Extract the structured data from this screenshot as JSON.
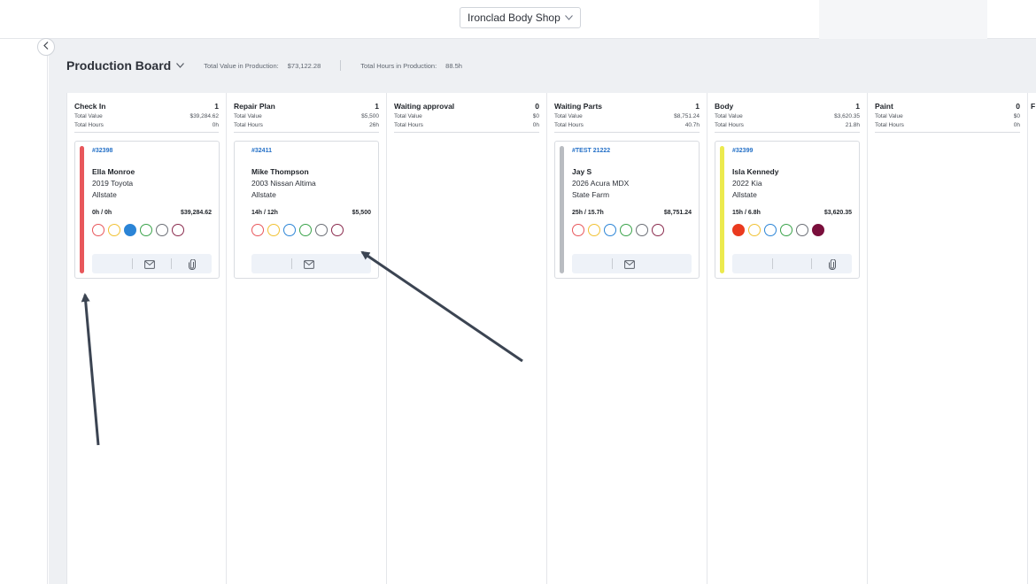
{
  "topbar": {
    "shop_name": "Ironclad Body Shop",
    "shop_chevron_icon": "chevron-down-icon"
  },
  "rail": {
    "collapse_icon": "chevron-left-icon"
  },
  "board": {
    "title": "Production Board",
    "total_value_label": "Total Value in Production:",
    "total_value": "$73,122.28",
    "total_hours_label": "Total Hours in Production:",
    "total_hours": "88.5h"
  },
  "columns": [
    {
      "name": "Check In",
      "count": "1",
      "value_label": "Total Value",
      "value": "$39,284.62",
      "hours_label": "Total Hours",
      "hours": "0h",
      "cards": [
        {
          "ro": "#32398",
          "customer": "Ella Monroe",
          "vehicle": "2019 Toyota",
          "insurer": "Allstate",
          "hours": "0h / 0h",
          "amount": "$39,284.62",
          "stripe_color": "#e8575b",
          "icons": [
            "mail-icon",
            "paperclip-icon"
          ],
          "dots": [
            {
              "stroke": "#e8575b",
              "fill": "none"
            },
            {
              "stroke": "#f1c233",
              "fill": "none"
            },
            {
              "stroke": "#2b84d6",
              "fill": "#2b84d6"
            },
            {
              "stroke": "#3aa34a",
              "fill": "none"
            },
            {
              "stroke": "#6b6f76",
              "fill": "none"
            },
            {
              "stroke": "#8a2a4d",
              "fill": "none"
            }
          ]
        }
      ]
    },
    {
      "name": "Repair Plan",
      "count": "1",
      "value_label": "Total Value",
      "value": "$5,500",
      "hours_label": "Total Hours",
      "hours": "26h",
      "cards": [
        {
          "ro": "#32411",
          "customer": "Mike Thompson",
          "vehicle": "2003 Nissan Altima",
          "insurer": "Allstate",
          "hours": "14h / 12h",
          "amount": "$5,500",
          "stripe_color": "",
          "icons": [
            "mail-icon"
          ],
          "dots": [
            {
              "stroke": "#e8575b",
              "fill": "none"
            },
            {
              "stroke": "#f1c233",
              "fill": "none"
            },
            {
              "stroke": "#2b84d6",
              "fill": "none"
            },
            {
              "stroke": "#3aa34a",
              "fill": "none"
            },
            {
              "stroke": "#6b6f76",
              "fill": "none"
            },
            {
              "stroke": "#8a2a4d",
              "fill": "none"
            }
          ]
        }
      ]
    },
    {
      "name": "Waiting approval",
      "count": "0",
      "value_label": "Total Value",
      "value": "$0",
      "hours_label": "Total Hours",
      "hours": "0h",
      "cards": []
    },
    {
      "name": "Waiting Parts",
      "count": "1",
      "value_label": "Total Value",
      "value": "$8,751.24",
      "hours_label": "Total Hours",
      "hours": "40.7h",
      "cards": [
        {
          "ro": "#TEST 21222",
          "customer": "Jay S",
          "vehicle": "2026 Acura MDX",
          "insurer": "State Farm",
          "hours": "25h / 15.7h",
          "amount": "$8,751.24",
          "stripe_color": "#b9bcc1",
          "icons": [
            "mail-icon"
          ],
          "dots": [
            {
              "stroke": "#e8575b",
              "fill": "none"
            },
            {
              "stroke": "#f1c233",
              "fill": "none"
            },
            {
              "stroke": "#2b84d6",
              "fill": "none"
            },
            {
              "stroke": "#3aa34a",
              "fill": "none"
            },
            {
              "stroke": "#6b6f76",
              "fill": "none"
            },
            {
              "stroke": "#8a2a4d",
              "fill": "none"
            }
          ]
        }
      ]
    },
    {
      "name": "Body",
      "count": "1",
      "value_label": "Total Value",
      "value": "$3,620.35",
      "hours_label": "Total Hours",
      "hours": "21.8h",
      "cards": [
        {
          "ro": "#32399",
          "customer": "Isla Kennedy",
          "vehicle": "2022 Kia",
          "insurer": "Allstate",
          "hours": "15h / 6.8h",
          "amount": "$3,620.35",
          "stripe_color": "#ecea4e",
          "icons": [
            "paperclip-icon"
          ],
          "dots": [
            {
              "stroke": "#ea3a1f",
              "fill": "#ea3a1f"
            },
            {
              "stroke": "#f1c233",
              "fill": "none"
            },
            {
              "stroke": "#2b84d6",
              "fill": "none"
            },
            {
              "stroke": "#3aa34a",
              "fill": "none"
            },
            {
              "stroke": "#6b6f76",
              "fill": "none"
            },
            {
              "stroke": "#7a0f3c",
              "fill": "#7a0f3c"
            }
          ]
        }
      ]
    },
    {
      "name": "Paint",
      "count": "0",
      "value_label": "Total Value",
      "value": "$0",
      "hours_label": "Total Hours",
      "hours": "0h",
      "cards": []
    }
  ],
  "partial_column": {
    "name": "F"
  }
}
